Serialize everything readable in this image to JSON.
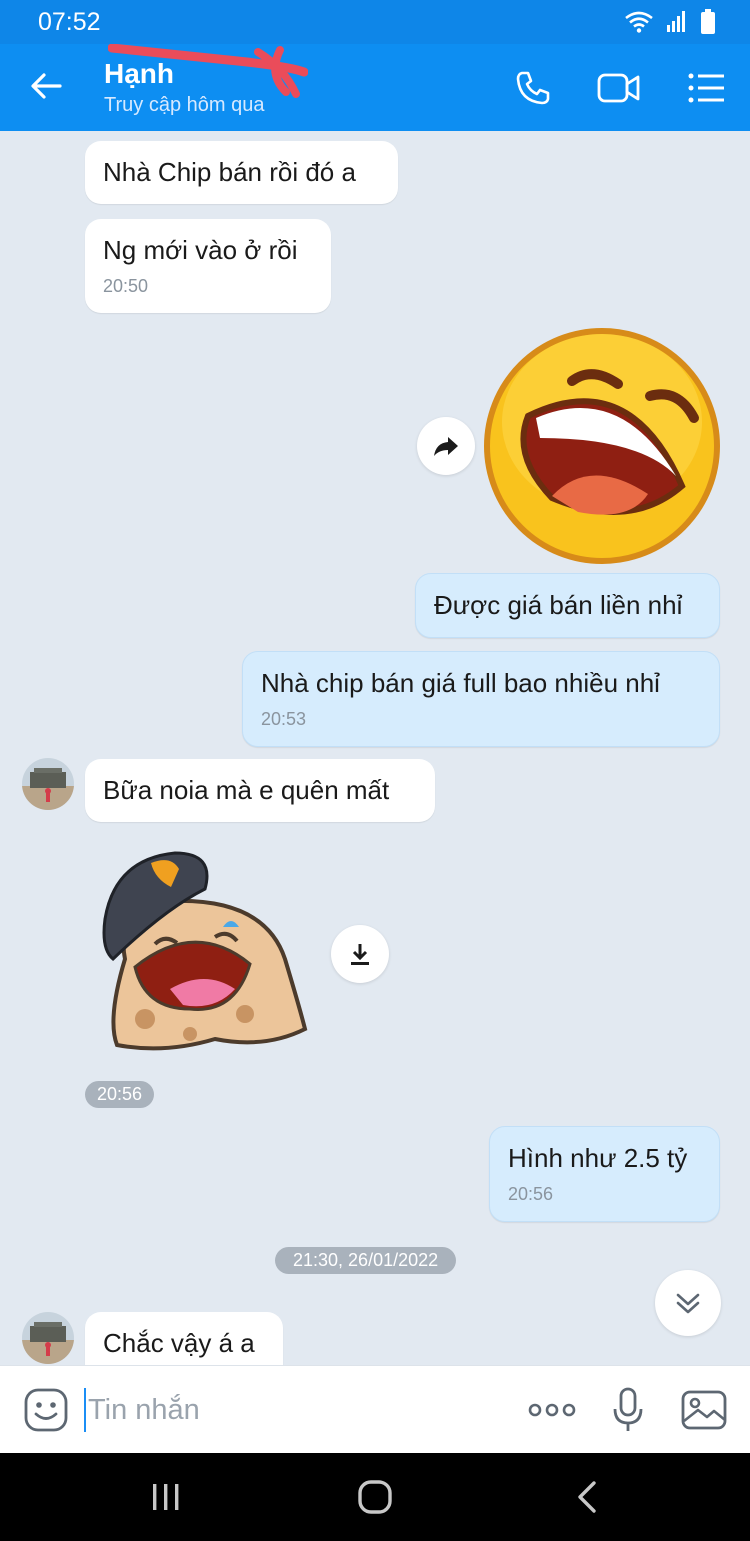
{
  "status_bar": {
    "time": "07:52",
    "icons": [
      "wifi-icon",
      "signal-icon",
      "battery-icon"
    ]
  },
  "header": {
    "contact_name": "Hạnh",
    "contact_status": "Truy cập hôm qua",
    "buttons": [
      "back-arrow-icon",
      "phone-icon",
      "video-call-icon",
      "menu-list-icon"
    ]
  },
  "messages": [
    {
      "side": "in",
      "text": "Nhà Chip bán rồi đó a"
    },
    {
      "side": "in",
      "text": "Ng mới vào ở rồi",
      "time": "20:50"
    },
    {
      "side": "out",
      "type": "sticker",
      "name": "laughing-emoji-sticker"
    },
    {
      "side": "out",
      "text": "Được giá bán liền nhỉ"
    },
    {
      "side": "out",
      "text": "Nhà chip bán giá full bao nhiều nhỉ",
      "time": "20:53"
    },
    {
      "side": "in",
      "text": "Bữa noia mà e quên mất"
    },
    {
      "side": "in",
      "type": "sticker",
      "name": "laughing-police-sticker",
      "time": "20:56"
    },
    {
      "side": "out",
      "text": "Hình như 2.5 tỷ",
      "time": "20:56"
    },
    {
      "side": "in",
      "text": "Chắc vậy á a"
    }
  ],
  "date_separator": "21:30, 26/01/2022",
  "input": {
    "placeholder": "Tin nhắn",
    "value": ""
  },
  "colors": {
    "header": "#0d8ef2",
    "outgoing_bubble": "#d6ecfd",
    "incoming_bubble": "#ffffff",
    "background": "#e2e9f1"
  }
}
